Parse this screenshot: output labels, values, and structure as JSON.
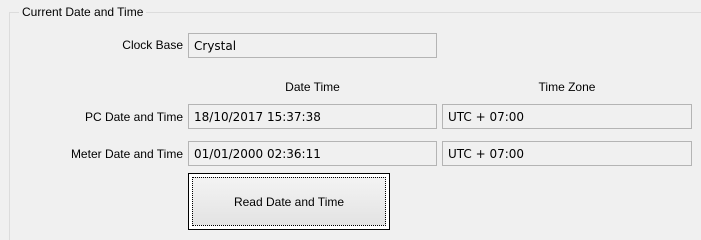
{
  "group": {
    "title": "Current Date and Time"
  },
  "clock_base": {
    "label": "Clock Base",
    "value": "Crystal"
  },
  "columns": {
    "date_time": "Date Time",
    "time_zone": "Time Zone"
  },
  "pc": {
    "label": "PC Date and Time",
    "date_time": "18/10/2017 15:37:38",
    "time_zone": "UTC + 07:00"
  },
  "meter": {
    "label": "Meter Date and Time",
    "date_time": "01/01/2000 02:36:11",
    "time_zone": "UTC + 07:00"
  },
  "actions": {
    "read_label": "Read Date and Time"
  }
}
